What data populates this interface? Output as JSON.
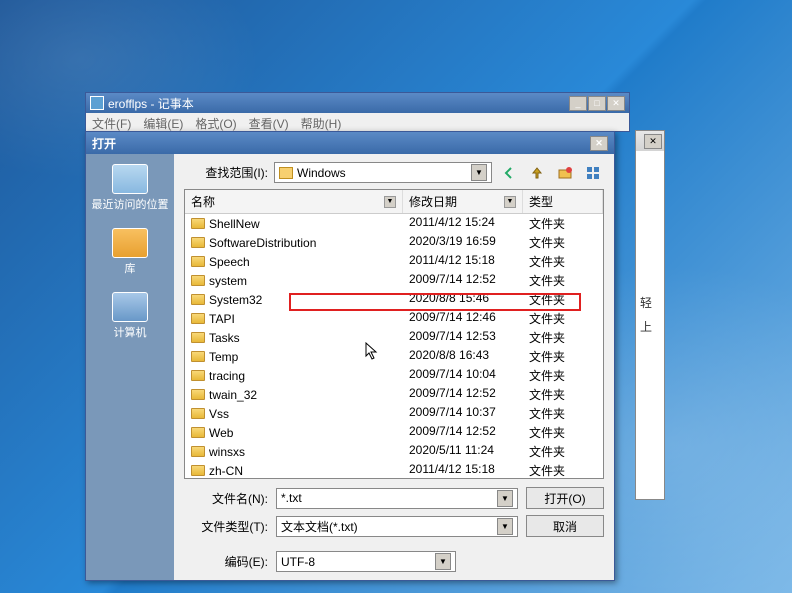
{
  "notepad": {
    "title": "erofflps - 记事本",
    "menu": [
      "文件(F)",
      "编辑(E)",
      "格式(O)",
      "查看(V)",
      "帮助(H)"
    ]
  },
  "back_window": {
    "line1": "轻",
    "line2": "上"
  },
  "dialog": {
    "title": "打开",
    "lookin_label": "查找范围(I):",
    "lookin_value": "Windows",
    "places": {
      "recent": "最近访问的位置",
      "library": "库",
      "computer": "计算机"
    },
    "columns": {
      "name": "名称",
      "date": "修改日期",
      "type": "类型"
    },
    "type_folder": "文件夹",
    "files": [
      {
        "name": "ShellNew",
        "date": "2011/4/12 15:24"
      },
      {
        "name": "SoftwareDistribution",
        "date": "2020/3/19 16:59"
      },
      {
        "name": "Speech",
        "date": "2011/4/12 15:18"
      },
      {
        "name": "system",
        "date": "2009/7/14 12:52"
      },
      {
        "name": "System32",
        "date": "2020/8/8 15:46"
      },
      {
        "name": "TAPI",
        "date": "2009/7/14 12:46"
      },
      {
        "name": "Tasks",
        "date": "2009/7/14 12:53"
      },
      {
        "name": "Temp",
        "date": "2020/8/8 16:43"
      },
      {
        "name": "tracing",
        "date": "2009/7/14 10:04"
      },
      {
        "name": "twain_32",
        "date": "2009/7/14 12:52"
      },
      {
        "name": "Vss",
        "date": "2009/7/14 10:37"
      },
      {
        "name": "Web",
        "date": "2009/7/14 12:52"
      },
      {
        "name": "winsxs",
        "date": "2020/5/11 11:24"
      },
      {
        "name": "zh-CN",
        "date": "2011/4/12 15:18"
      }
    ],
    "filename_label": "文件名(N):",
    "filename_value": "*.txt",
    "filetype_label": "文件类型(T):",
    "filetype_value": "文本文档(*.txt)",
    "encoding_label": "编码(E):",
    "encoding_value": "UTF-8",
    "open_btn": "打开(O)",
    "cancel_btn": "取消"
  }
}
